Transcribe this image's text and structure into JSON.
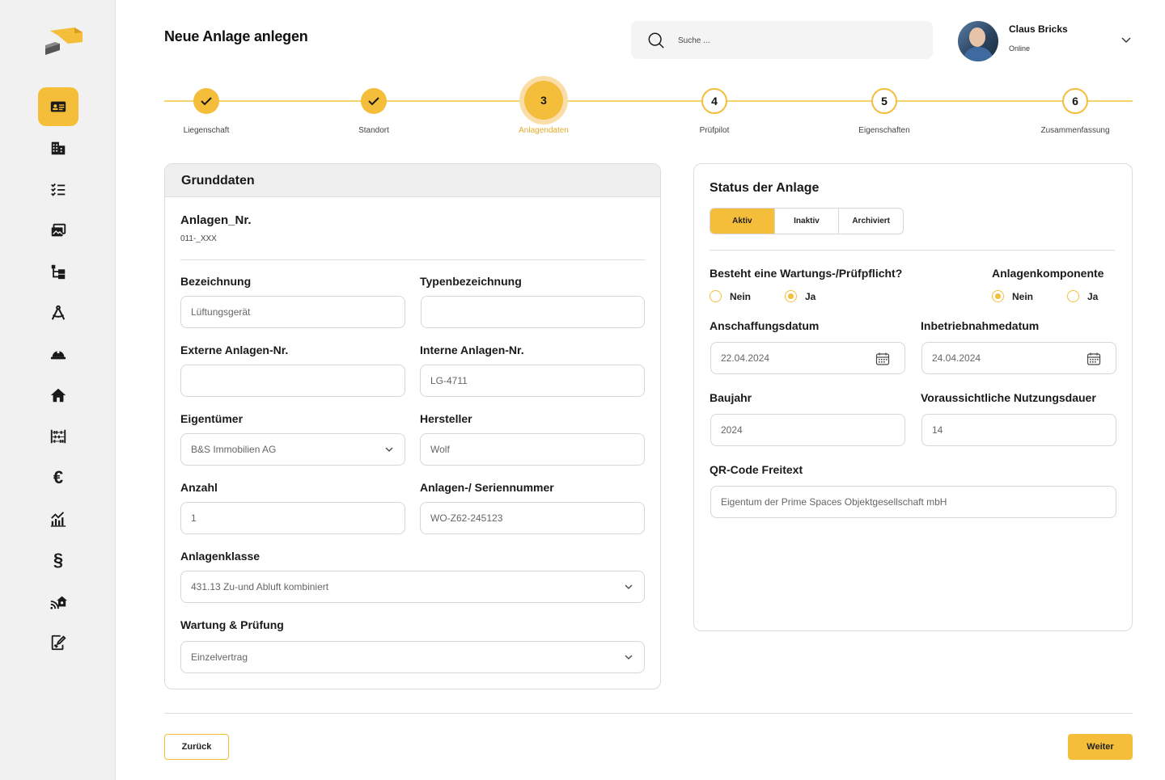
{
  "page": {
    "title": "Neue Anlage anlegen"
  },
  "search": {
    "placeholder": "Suche ..."
  },
  "user": {
    "name": "Claus Bricks",
    "status": "Online"
  },
  "sidebar": {
    "items": [
      {
        "icon": "id-card-icon",
        "active": true
      },
      {
        "icon": "buildings-icon",
        "active": false
      },
      {
        "icon": "checklist-icon",
        "active": false
      },
      {
        "icon": "documents-icon",
        "active": false
      },
      {
        "icon": "hierarchy-icon",
        "active": false
      },
      {
        "icon": "drafting-compass-icon",
        "active": false
      },
      {
        "icon": "hard-hat-icon",
        "active": false
      },
      {
        "icon": "home-icon",
        "active": false
      },
      {
        "icon": "abacus-icon",
        "active": false
      },
      {
        "icon": "euro-icon",
        "glyph": "€",
        "active": false
      },
      {
        "icon": "chart-icon",
        "active": false
      },
      {
        "icon": "paragraph-icon",
        "glyph": "§",
        "active": false
      },
      {
        "icon": "smart-home-icon",
        "active": false
      },
      {
        "icon": "signature-icon",
        "active": false
      }
    ]
  },
  "stepper": {
    "steps": [
      {
        "number": "1",
        "label": "Liegenschaft",
        "state": "done"
      },
      {
        "number": "2",
        "label": "Standort",
        "state": "done"
      },
      {
        "number": "3",
        "label": "Anlagendaten",
        "state": "current"
      },
      {
        "number": "4",
        "label": "Prüfpilot",
        "state": "todo"
      },
      {
        "number": "5",
        "label": "Eigenschaften",
        "state": "todo"
      },
      {
        "number": "6",
        "label": "Zusammenfassung",
        "state": "todo"
      }
    ]
  },
  "grunddaten": {
    "header": "Grunddaten",
    "anlagen_nr_label": "Anlagen_Nr.",
    "anlagen_nr_value": "011-_XXX",
    "bezeichnung": {
      "label": "Bezeichnung",
      "value": "Lüftungsgerät"
    },
    "typenbezeichnung": {
      "label": "Typenbezeichnung",
      "value": ""
    },
    "externe_nr": {
      "label": "Externe Anlagen-Nr.",
      "value": ""
    },
    "interne_nr": {
      "label": "Interne Anlagen-Nr.",
      "value": "LG-4711"
    },
    "eigentuemer": {
      "label": "Eigentümer",
      "value": "B&S Immobilien AG"
    },
    "hersteller": {
      "label": "Hersteller",
      "value": "Wolf"
    },
    "anzahl": {
      "label": "Anzahl",
      "value": "1"
    },
    "seriennummer": {
      "label": "Anlagen-/ Seriennummer",
      "value": "WO-Z62-245123"
    },
    "anlagenklasse": {
      "label": "Anlagenklasse",
      "value": "431.13 Zu-und Abluft kombiniert"
    },
    "wartung": {
      "label": "Wartung & Prüfung",
      "value": "Einzelvertrag"
    }
  },
  "status": {
    "header": "Status der Anlage",
    "segments": [
      "Aktiv",
      "Inaktiv",
      "Archiviert"
    ],
    "selected_segment": "Aktiv",
    "wartungspflicht": {
      "label": "Besteht eine Wartungs-/Prüfpflicht?",
      "options": [
        "Nein",
        "Ja"
      ],
      "selected": "Ja"
    },
    "komponente": {
      "label": "Anlagenkomponente",
      "options": [
        "Nein",
        "Ja"
      ],
      "selected": "Nein"
    },
    "anschaffungsdatum": {
      "label": "Anschaffungsdatum",
      "value": "22.04.2024"
    },
    "inbetriebnahmedatum": {
      "label": "Inbetriebnahmedatum",
      "value": "24.04.2024"
    },
    "baujahr": {
      "label": "Baujahr",
      "value": "2024"
    },
    "nutzungsdauer": {
      "label": "Voraussichtliche Nutzungsdauer",
      "value": "14"
    },
    "qr_freitext": {
      "label": "QR-Code Freitext",
      "value": "Eigentum der Prime Spaces Objektgesellschaft mbH"
    }
  },
  "footer": {
    "back_label": "Zurück",
    "next_label": "Weiter"
  },
  "colors": {
    "accent": "#f4be3a",
    "accent_light": "#f9deaa",
    "sidebar_bg": "#f1f1f1"
  }
}
